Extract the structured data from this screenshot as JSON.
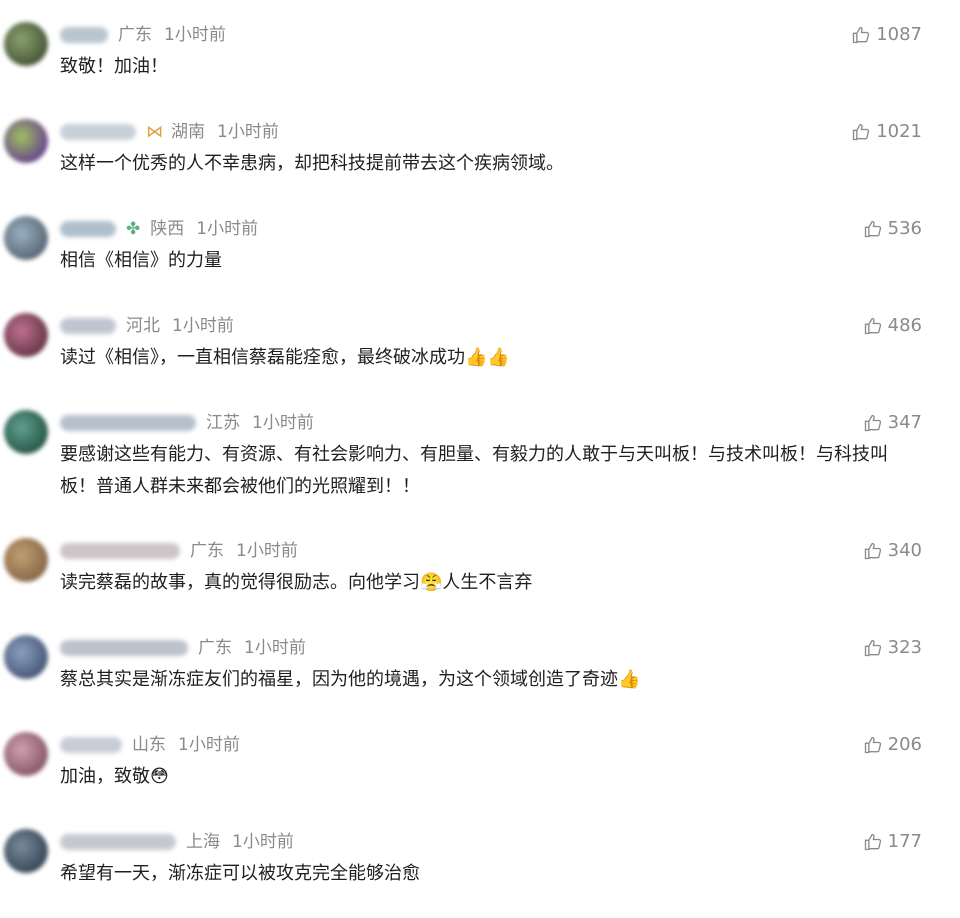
{
  "comments": [
    {
      "region": "广东",
      "time": "1小时前",
      "text": "致敬！加油！",
      "likes": "1087",
      "avatar": "#4a5a3a",
      "name_color": "#b8c4d0"
    },
    {
      "region": "湖南",
      "time": "1小时前",
      "text": "这样一个优秀的人不幸患病，却把科技提前带去这个疾病领域。",
      "likes": "1021",
      "avatar": "#6a4a8a",
      "name_color": "#c8cfd8"
    },
    {
      "region": "陕西",
      "time": "1小时前",
      "text": "相信《相信》的力量",
      "likes": "536",
      "avatar": "#5a6a7a",
      "name_color": "#aebfcc"
    },
    {
      "region": "河北",
      "time": "1小时前",
      "text": "读过《相信》，一直相信蔡磊能痊愈，最终破冰成功👍👍",
      "likes": "486",
      "avatar": "#6a3a4a",
      "name_color": "#c0c6d0"
    },
    {
      "region": "江苏",
      "time": "1小时前",
      "text": "要感谢这些有能力、有资源、有社会影响力、有胆量、有毅力的人敢于与天叫板！与技术叫板！与科技叫板！普通人群未来都会被他们的光照耀到！！",
      "likes": "347",
      "avatar": "#2a5a4a",
      "name_color": "#b6c0cc"
    },
    {
      "region": "广东",
      "time": "1小时前",
      "text": "读完蔡磊的故事，真的觉得很励志。向他学习😤人生不言弃",
      "likes": "340",
      "avatar": "#8a6a4a",
      "name_color": "#ccc4c8"
    },
    {
      "region": "广东",
      "time": "1小时前",
      "text": "蔡总其实是渐冻症友们的福星，因为他的境遇，为这个领域创造了奇迹👍",
      "likes": "323",
      "avatar": "#4a5a7a",
      "name_color": "#bcc2cc"
    },
    {
      "region": "山东",
      "time": "1小时前",
      "text": "加油，致敬😳",
      "likes": "206",
      "avatar": "#8a5a6a",
      "name_color": "#c8ccd8"
    },
    {
      "region": "上海",
      "time": "1小时前",
      "text": "希望有一天，渐冻症可以被攻克完全能够治愈",
      "likes": "177",
      "avatar": "#3a4a5a",
      "name_color": "#c4c8d0"
    }
  ]
}
